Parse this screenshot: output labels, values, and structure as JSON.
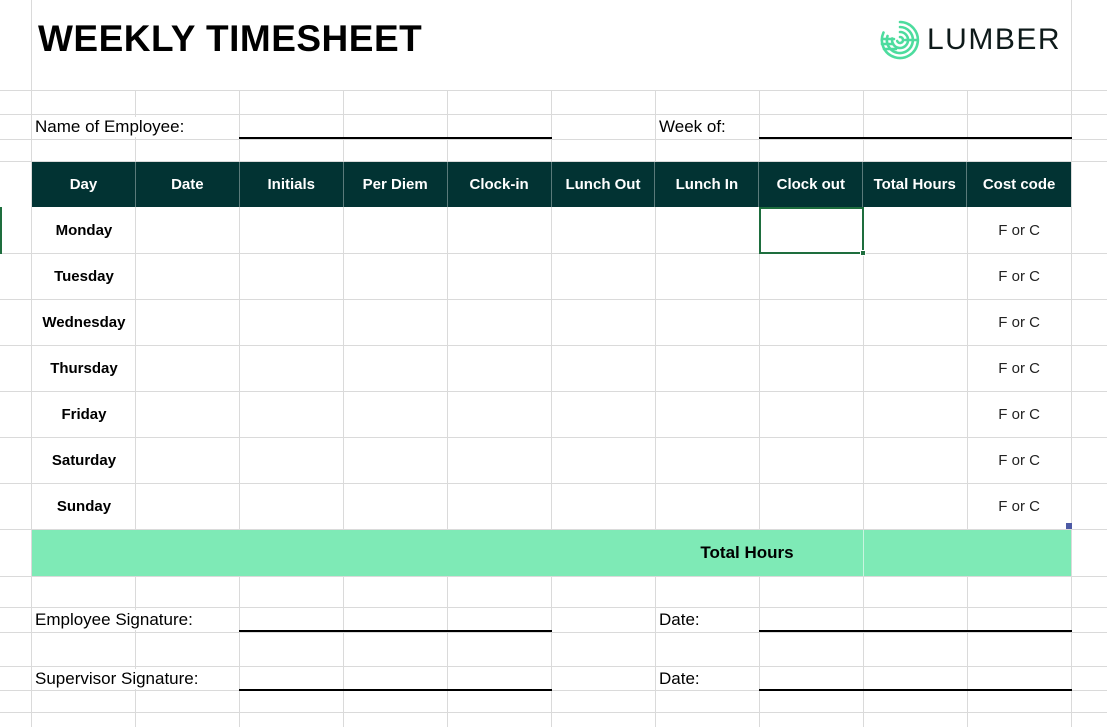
{
  "title": "WEEKLY TIMESHEET",
  "logo": {
    "text": "LUMBER",
    "icon": "lumber-fingerprint-logo-icon",
    "color": "#4ddc9e"
  },
  "fields": {
    "employee_name_label": "Name of Employee:",
    "week_of_label": "Week of:",
    "employee_signature_label": "Employee Signature:",
    "supervisor_signature_label": "Supervisor Signature:",
    "date_label_1": "Date:",
    "date_label_2": "Date:"
  },
  "table": {
    "headers": [
      "Day",
      "Date",
      "Initials",
      "Per Diem",
      "Clock-in",
      "Lunch Out",
      "Lunch In",
      "Clock out",
      "Total Hours",
      "Cost code"
    ],
    "rows": [
      {
        "day": "Monday",
        "cost_code": "F or C"
      },
      {
        "day": "Tuesday",
        "cost_code": "F or C"
      },
      {
        "day": "Wednesday",
        "cost_code": "F or C"
      },
      {
        "day": "Thursday",
        "cost_code": "F or C"
      },
      {
        "day": "Friday",
        "cost_code": "F or C"
      },
      {
        "day": "Saturday",
        "cost_code": "F or C"
      },
      {
        "day": "Sunday",
        "cost_code": "F or C"
      }
    ],
    "total_label": "Total Hours"
  },
  "colors": {
    "header_bg": "#023333",
    "total_bg": "#7eeab6",
    "selection": "#1e6e3e"
  }
}
